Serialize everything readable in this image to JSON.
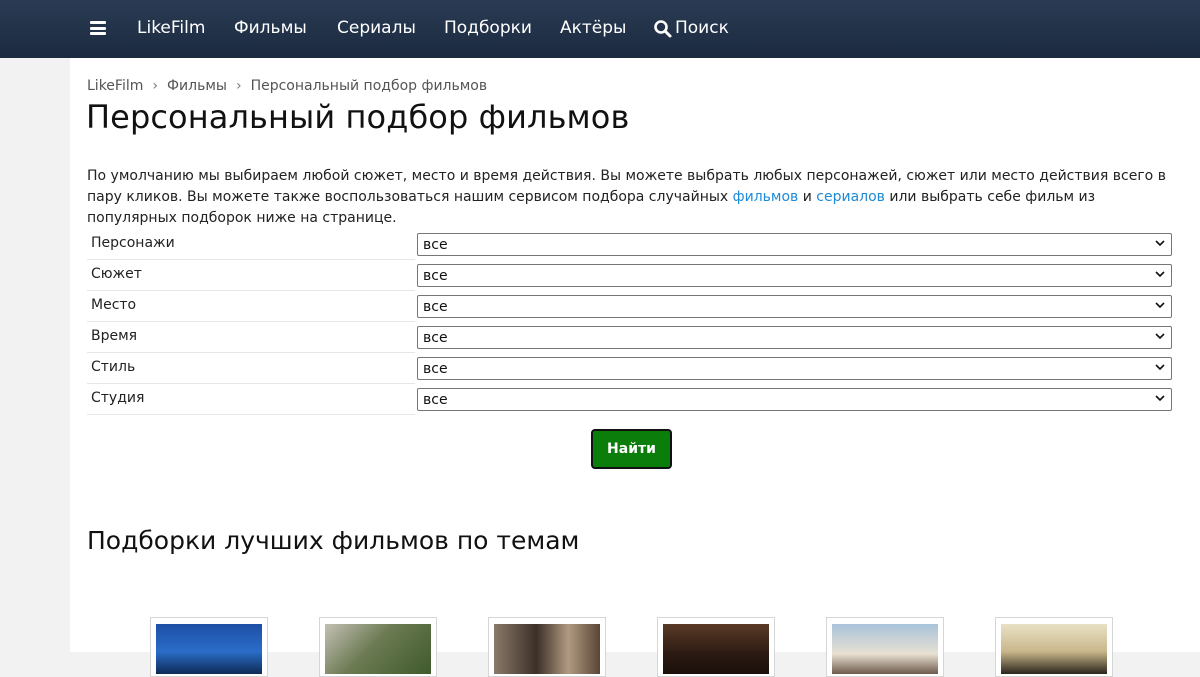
{
  "nav": {
    "brand": "LikeFilm",
    "items": [
      "Фильмы",
      "Сериалы",
      "Подборки",
      "Актёры"
    ],
    "search_label": "Поиск"
  },
  "breadcrumb": [
    "LikeFilm",
    "Фильмы",
    "Персональный подбор фильмов"
  ],
  "page_title": "Персональный подбор фильмов",
  "intro": {
    "part1": "По умолчанию мы выбираем любой сюжет, место и время действия. Вы можете выбрать любых персонажей, сюжет или место действия всего в пару кликов. Вы можете также воспользоваться нашим сервисом подбора случайных ",
    "link_films": "фильмов",
    "and": " и ",
    "link_series": "сериалов",
    "part2": " или выбрать себе фильм из популярных подборок ниже на странице."
  },
  "filters": [
    {
      "label": "Персонажи",
      "value": "все"
    },
    {
      "label": "Сюжет",
      "value": "все"
    },
    {
      "label": "Место",
      "value": "все"
    },
    {
      "label": "Время",
      "value": "все"
    },
    {
      "label": "Стиль",
      "value": "все"
    },
    {
      "label": "Студия",
      "value": "все"
    }
  ],
  "find_button": "Найти",
  "section_title": "Подборки лучших фильмов по темам",
  "colors": {
    "nav_bg": "#1f2f46",
    "link": "#1e8ad6",
    "button_bg": "#0b7d0b"
  }
}
